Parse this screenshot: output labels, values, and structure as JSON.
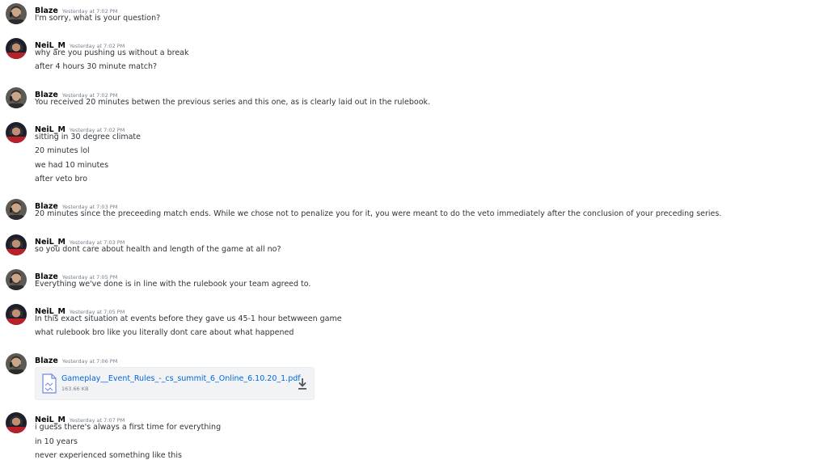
{
  "colors": {
    "author": "#060607",
    "text": "#2e3338",
    "timestamp": "#747f8d",
    "link": "#0068e0",
    "attachment_bg": "#f2f3f5"
  },
  "messages": [
    {
      "author": "Blaze",
      "timestamp": "Yesterday at 7:02 PM",
      "avatar": "blaze-avatar",
      "lines": [
        "I'm sorry, what is your question?"
      ]
    },
    {
      "author": "NeiL_M",
      "timestamp": "Yesterday at 7:02 PM",
      "avatar": "neil-avatar",
      "lines": [
        "why are you pushing us without a break",
        "after 4 hours 30 minute match?"
      ]
    },
    {
      "author": "Blaze",
      "timestamp": "Yesterday at 7:02 PM",
      "avatar": "blaze-avatar",
      "lines": [
        "You received 20 minutes betwen the previous series and this one, as is clearly laid out in the rulebook."
      ]
    },
    {
      "author": "NeiL_M",
      "timestamp": "Yesterday at 7:02 PM",
      "avatar": "neil-avatar",
      "lines": [
        "sitting in 30 degree climate",
        "20 minutes lol",
        "we had 10 minutes",
        "after veto bro"
      ]
    },
    {
      "author": "Blaze",
      "timestamp": "Yesterday at 7:03 PM",
      "avatar": "blaze-avatar",
      "lines": [
        "20 minutes since the preceeding match ends. While we chose not to penalize you for it, you were meant to do the veto immediately after the conclusion of your preceding series."
      ]
    },
    {
      "author": "NeiL_M",
      "timestamp": "Yesterday at 7:03 PM",
      "avatar": "neil-avatar",
      "lines": [
        "so you dont care about health and length of the game at all no?"
      ]
    },
    {
      "author": "Blaze",
      "timestamp": "Yesterday at 7:05 PM",
      "avatar": "blaze-avatar",
      "lines": [
        "Everything we've done is in line with the rulebook your team agreed to."
      ]
    },
    {
      "author": "NeiL_M",
      "timestamp": "Yesterday at 7:05 PM",
      "avatar": "neil-avatar",
      "lines": [
        "In this exact situation at events before they gave us 45-1 hour betwween game",
        "what rulebook bro like you literally dont care about what happened"
      ]
    },
    {
      "author": "Blaze",
      "timestamp": "Yesterday at 7:06 PM",
      "avatar": "blaze-avatar",
      "lines": [],
      "attachment": {
        "file_name": "Gameplay__Event_Rules_-_cs_summit_6_Online_6.10.20_1.pdf",
        "file_size": "163.66 KB",
        "file_icon": "document-icon",
        "download_icon": "download-icon"
      }
    },
    {
      "author": "NeiL_M",
      "timestamp": "Yesterday at 7:07 PM",
      "avatar": "neil-avatar",
      "lines": [
        "i guess there's always a first time for everything",
        "in 10 years",
        "never experienced something like this"
      ]
    }
  ]
}
